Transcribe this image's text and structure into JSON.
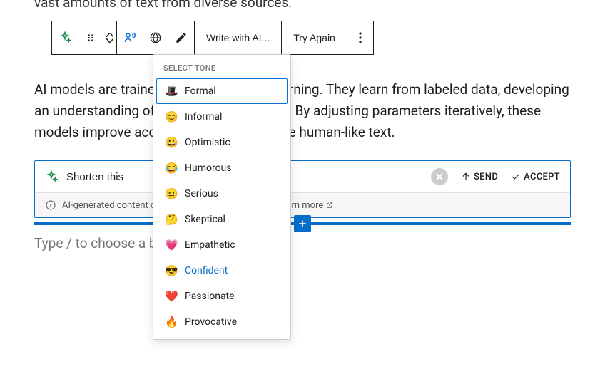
{
  "truncated_text": "vast amounts of text from diverse sources.",
  "toolbar": {
    "write_label": "Write with AI...",
    "try_again_label": "Try Again"
  },
  "paragraph": "AI models are trained using supervised learning. They learn from labeled data, developing an understanding of language and context. By adjusting parameters iteratively, these models improve accuracy and can generate human-like text.",
  "ai_panel": {
    "input_value": "Shorten this",
    "send_label": "SEND",
    "accept_label": "ACCEPT",
    "disclaimer_text": "AI-generated content could be inaccurate or biased.",
    "learn_more": "Learn more"
  },
  "placeholder": "Type / to choose a block",
  "dropdown": {
    "header": "SELECT TONE",
    "items": [
      {
        "emoji": "🎩",
        "label": "Formal",
        "state": "selected"
      },
      {
        "emoji": "😊",
        "label": "Informal",
        "state": ""
      },
      {
        "emoji": "😃",
        "label": "Optimistic",
        "state": ""
      },
      {
        "emoji": "😂",
        "label": "Humorous",
        "state": ""
      },
      {
        "emoji": "😐",
        "label": "Serious",
        "state": ""
      },
      {
        "emoji": "🤔",
        "label": "Skeptical",
        "state": ""
      },
      {
        "emoji": "💗",
        "label": "Empathetic",
        "state": ""
      },
      {
        "emoji": "😎",
        "label": "Confident",
        "state": "hover"
      },
      {
        "emoji": "❤️",
        "label": "Passionate",
        "state": ""
      },
      {
        "emoji": "🔥",
        "label": "Provocative",
        "state": ""
      }
    ]
  }
}
